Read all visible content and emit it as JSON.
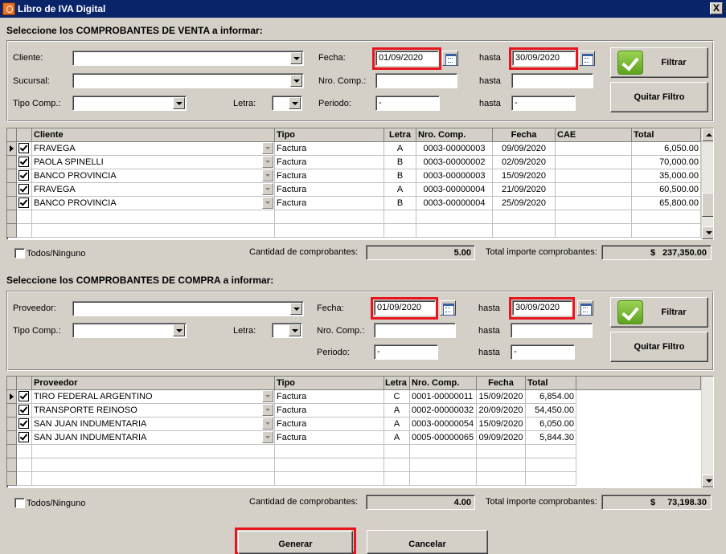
{
  "window": {
    "title": "Libro de IVA Digital",
    "close_label": "X"
  },
  "venta": {
    "section_title": "Seleccione los COMPROBANTES DE VENTA a informar:",
    "filters": {
      "cliente_label": "Cliente:",
      "cliente_value": "",
      "sucursal_label": "Sucursal:",
      "sucursal_value": "",
      "tipo_comp_label": "Tipo Comp.:",
      "tipo_comp_value": "",
      "letra_label": "Letra:",
      "letra_value": "",
      "fecha_label": "Fecha:",
      "fecha_from": "01/09/2020",
      "hasta_label": "hasta",
      "fecha_to": "30/09/2020",
      "nro_comp_label": "Nro. Comp.:",
      "nro_comp_from": "",
      "nro_comp_to": "",
      "periodo_label": "Periodo:",
      "periodo_from": "-",
      "periodo_to": "-",
      "filtrar_label": "Filtrar",
      "quitar_filtro_label": "Quitar Filtro"
    },
    "columns": [
      "Cliente",
      "Tipo",
      "Letra",
      "Nro. Comp.",
      "Fecha",
      "CAE",
      "Total"
    ],
    "rows": [
      {
        "checked": true,
        "cliente": "FRAVEGA",
        "tipo": "Factura",
        "letra": "A",
        "nro": "0003-00000003",
        "fecha": "09/09/2020",
        "cae": "",
        "total": "6,050.00"
      },
      {
        "checked": true,
        "cliente": "PAOLA SPINELLI",
        "tipo": "Factura",
        "letra": "B",
        "nro": "0003-00000002",
        "fecha": "02/09/2020",
        "cae": "",
        "total": "70,000.00"
      },
      {
        "checked": true,
        "cliente": "BANCO PROVINCIA",
        "tipo": "Factura",
        "letra": "B",
        "nro": "0003-00000003",
        "fecha": "15/09/2020",
        "cae": "",
        "total": "35,000.00"
      },
      {
        "checked": true,
        "cliente": "FRAVEGA",
        "tipo": "Factura",
        "letra": "A",
        "nro": "0003-00000004",
        "fecha": "21/09/2020",
        "cae": "",
        "total": "60,500.00"
      },
      {
        "checked": true,
        "cliente": "BANCO PROVINCIA",
        "tipo": "Factura",
        "letra": "B",
        "nro": "0003-00000004",
        "fecha": "25/09/2020",
        "cae": "",
        "total": "65,800.00"
      }
    ],
    "todos_label": "Todos/Ninguno",
    "cantidad_label": "Cantidad de comprobantes:",
    "cantidad_value": "5.00",
    "total_label": "Total importe comprobantes:",
    "total_currency": "$",
    "total_value": "237,350.00"
  },
  "compra": {
    "section_title": "Seleccione los COMPROBANTES DE COMPRA a informar:",
    "filters": {
      "proveedor_label": "Proveedor:",
      "proveedor_value": "",
      "tipo_comp_label": "Tipo Comp.:",
      "tipo_comp_value": "",
      "letra_label": "Letra:",
      "letra_value": "",
      "fecha_label": "Fecha:",
      "fecha_from": "01/09/2020",
      "hasta_label": "hasta",
      "fecha_to": "30/09/2020",
      "nro_comp_label": "Nro. Comp.:",
      "nro_comp_from": "",
      "nro_comp_to": "",
      "periodo_label": "Periodo:",
      "periodo_from": "-",
      "periodo_to": "-",
      "filtrar_label": "Filtrar",
      "quitar_filtro_label": "Quitar Filtro"
    },
    "columns": [
      "Proveedor",
      "Tipo",
      "Letra",
      "Nro. Comp.",
      "Fecha",
      "Total"
    ],
    "rows": [
      {
        "checked": true,
        "proveedor": "TIRO FEDERAL ARGENTINO",
        "tipo": "Factura",
        "letra": "C",
        "nro": "0001-00000011",
        "fecha": "15/09/2020",
        "total": "6,854.00"
      },
      {
        "checked": true,
        "proveedor": "TRANSPORTE REINOSO",
        "tipo": "Factura",
        "letra": "A",
        "nro": "0002-00000032",
        "fecha": "20/09/2020",
        "total": "54,450.00"
      },
      {
        "checked": true,
        "proveedor": "SAN JUAN INDUMENTARIA",
        "tipo": "Factura",
        "letra": "A",
        "nro": "0003-00000054",
        "fecha": "15/09/2020",
        "total": "6,050.00"
      },
      {
        "checked": true,
        "proveedor": "SAN JUAN INDUMENTARIA",
        "tipo": "Factura",
        "letra": "A",
        "nro": "0005-00000065",
        "fecha": "09/09/2020",
        "total": "5,844.30"
      }
    ],
    "todos_label": "Todos/Ninguno",
    "cantidad_label": "Cantidad de comprobantes:",
    "cantidad_value": "4.00",
    "total_label": "Total importe comprobantes:",
    "total_currency": "$",
    "total_value": "73,198.30"
  },
  "footer": {
    "generar_label": "Generar",
    "cancelar_label": "Cancelar"
  },
  "colors": {
    "highlight": "#e8141e",
    "titlebar": "#0a246a",
    "face": "#d4d0c8"
  }
}
